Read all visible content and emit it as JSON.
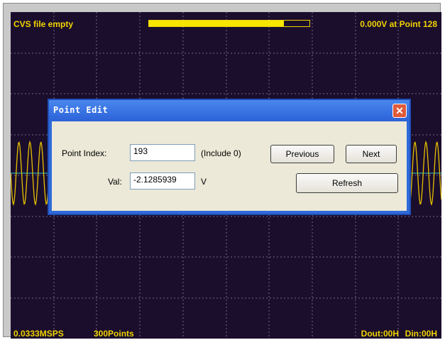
{
  "scope": {
    "status_left": "CVS file empty",
    "readout": "0.000V at Point 128",
    "progress_fraction": 0.84,
    "sample_rate": "0.0333MSPS",
    "points": "300Points",
    "dout": "Dout:00H",
    "din": "Din:00H",
    "colors": {
      "background": "#1b0d2c",
      "trace": "#e6c000",
      "grid": "#6f6a86",
      "center_line": "#2ad0d0",
      "hud_text": "#f1d400"
    }
  },
  "dialog": {
    "title": "Point Edit",
    "close_glyph": "✕",
    "point_index_label": "Point Index:",
    "point_index_value": "193",
    "include_note": "(Include 0)",
    "previous_label": "Previous",
    "next_label": "Next",
    "val_label": "Val:",
    "val_value": "-2.1285939",
    "unit": "V",
    "refresh_label": "Refresh"
  }
}
